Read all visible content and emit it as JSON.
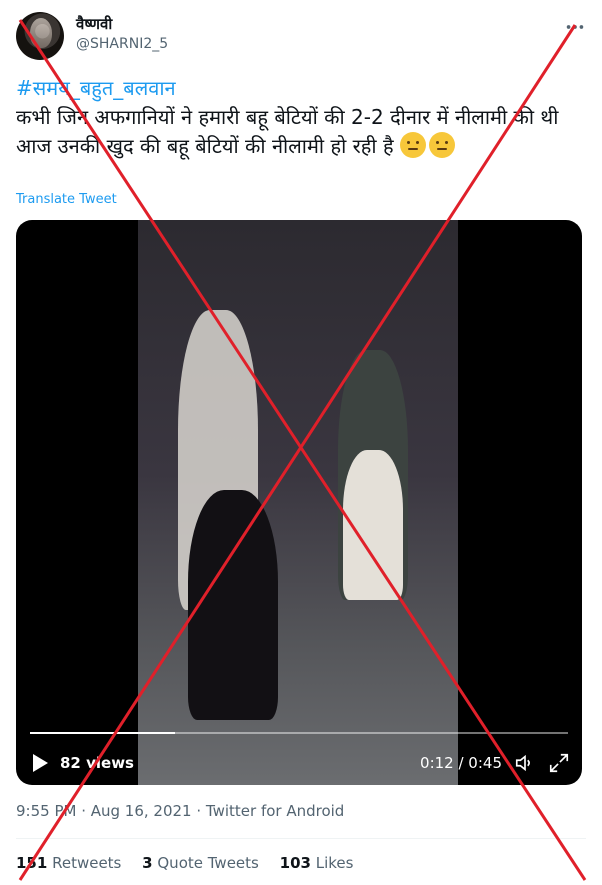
{
  "user": {
    "display_name": "वैष्णवी",
    "handle": "@SHARNI2_5"
  },
  "tweet": {
    "hashtag": "#समय_बहुत_बलवान",
    "text": "कभी जिन अफगानियों ने हमारी बहू बेटियों की 2-2 दीनार में नीलामी की थी आज उनकी खुद की बहू बेटियों की नीलामी हो रही है",
    "translate_label": "Translate Tweet",
    "timestamp": "9:55 PM · Aug 16, 2021 · Twitter for Android"
  },
  "video": {
    "views": "82 views",
    "time": "0:12 / 0:45",
    "progress": 0.27
  },
  "stats": {
    "retweets_count": "151",
    "retweets_label": "Retweets",
    "quotes_count": "3",
    "quotes_label": "Quote Tweets",
    "likes_count": "103",
    "likes_label": "Likes"
  },
  "icons": {
    "more": "more-icon",
    "play": "play-icon",
    "volume": "volume-icon",
    "fullscreen": "fullscreen-icon"
  },
  "colors": {
    "link": "#1d9bf0",
    "fake_cross": "#e0202a"
  }
}
